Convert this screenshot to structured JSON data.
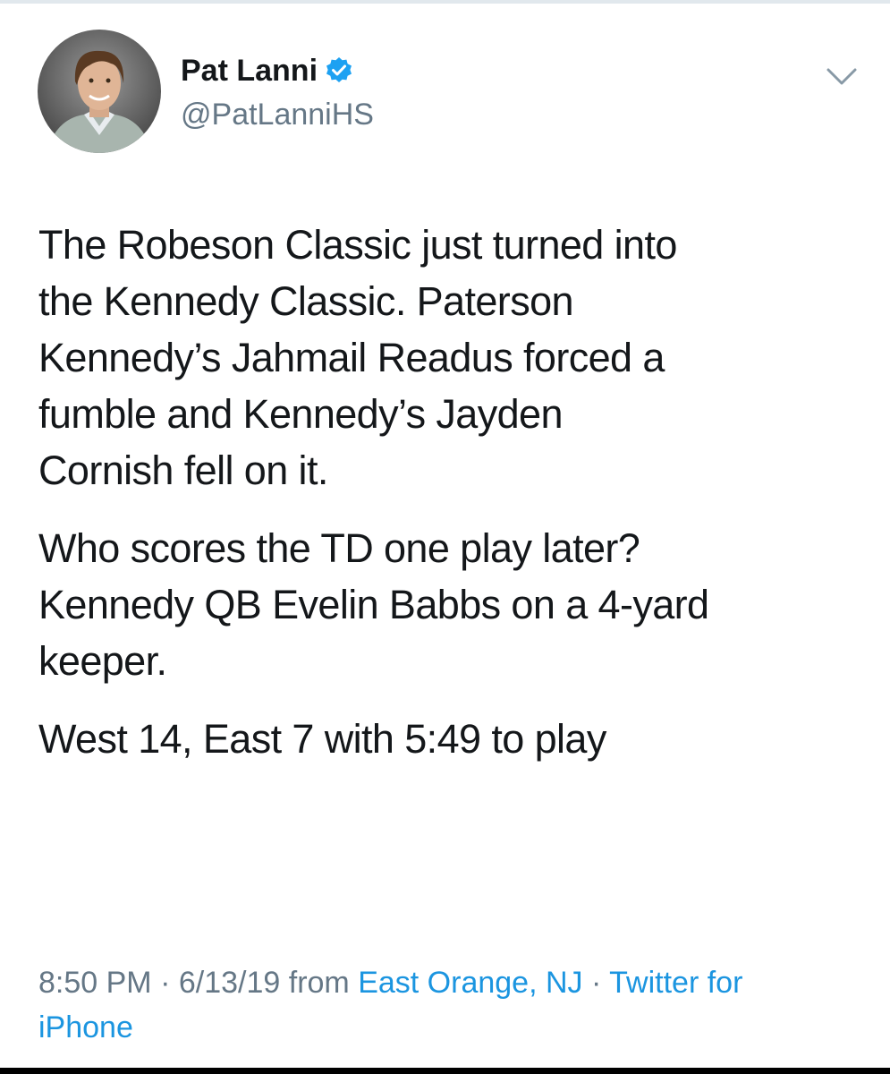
{
  "user": {
    "display_name": "Pat Lanni",
    "handle": "@PatLanniHS",
    "verified": true,
    "avatar_icon": "profile-photo"
  },
  "tweet": {
    "paragraph_1": "The Robeson Classic just turned into\nthe Kennedy Classic. Paterson\nKennedy’s Jahmail Readus forced a\nfumble and Kennedy’s Jayden\nCornish fell on it.",
    "paragraph_2": "Who scores the TD one play later?\nKennedy QB Evelin Babbs on a 4-yard\nkeeper.",
    "paragraph_3": "West 14, East 7 with 5:49 to play"
  },
  "meta": {
    "time": "8:50 PM",
    "separator": " · ",
    "date": "6/13/19",
    "from_label": " from ",
    "location": "East Orange, NJ",
    "source": "Twitter for iPhone"
  },
  "colors": {
    "text": "#14171a",
    "secondary": "#657786",
    "link": "#1b95e0",
    "verified": "#1da1f2"
  },
  "icons": {
    "verified": "verified-badge-icon",
    "menu": "chevron-down-icon"
  }
}
